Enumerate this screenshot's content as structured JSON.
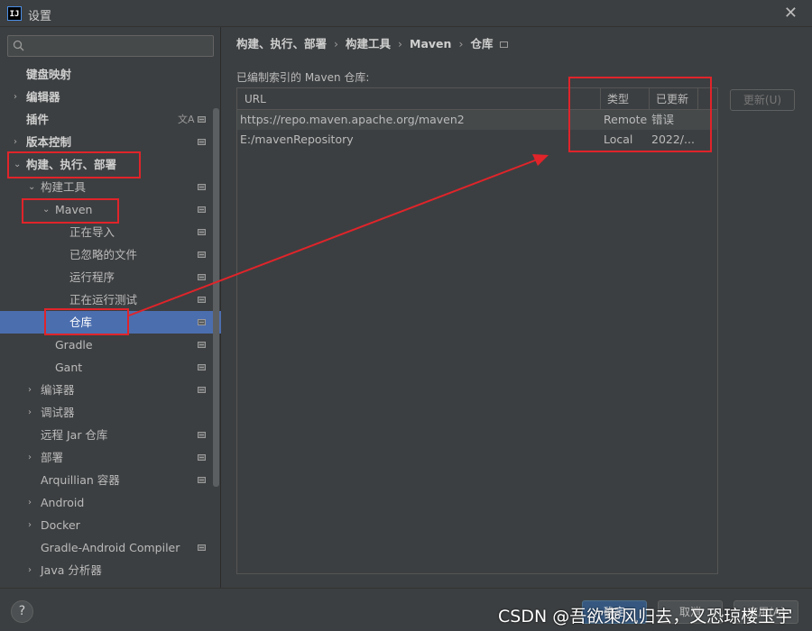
{
  "window": {
    "title": "设置",
    "app_icon_text": "IJ"
  },
  "search": {
    "placeholder": ""
  },
  "sidebar": {
    "items": [
      {
        "label": "键盘映射",
        "indent": 0,
        "arrow": "",
        "bold": true,
        "proj": false,
        "lang": false,
        "selected": false
      },
      {
        "label": "编辑器",
        "indent": 0,
        "arrow": "›",
        "bold": true,
        "proj": false,
        "lang": false,
        "selected": false
      },
      {
        "label": "插件",
        "indent": 0,
        "arrow": "",
        "bold": true,
        "proj": true,
        "lang": true,
        "selected": false
      },
      {
        "label": "版本控制",
        "indent": 0,
        "arrow": "›",
        "bold": true,
        "proj": true,
        "lang": false,
        "selected": false
      },
      {
        "label": "构建、执行、部署",
        "indent": 0,
        "arrow": "⌄",
        "bold": true,
        "proj": false,
        "lang": false,
        "selected": false
      },
      {
        "label": "构建工具",
        "indent": 1,
        "arrow": "⌄",
        "bold": false,
        "proj": true,
        "lang": false,
        "selected": false
      },
      {
        "label": "Maven",
        "indent": 2,
        "arrow": "⌄",
        "bold": false,
        "proj": true,
        "lang": false,
        "selected": false
      },
      {
        "label": "正在导入",
        "indent": 3,
        "arrow": "",
        "bold": false,
        "proj": true,
        "lang": false,
        "selected": false
      },
      {
        "label": "已忽略的文件",
        "indent": 3,
        "arrow": "",
        "bold": false,
        "proj": true,
        "lang": false,
        "selected": false
      },
      {
        "label": "运行程序",
        "indent": 3,
        "arrow": "",
        "bold": false,
        "proj": true,
        "lang": false,
        "selected": false
      },
      {
        "label": "正在运行测试",
        "indent": 3,
        "arrow": "",
        "bold": false,
        "proj": true,
        "lang": false,
        "selected": false
      },
      {
        "label": "仓库",
        "indent": 3,
        "arrow": "",
        "bold": false,
        "proj": true,
        "lang": false,
        "selected": true
      },
      {
        "label": "Gradle",
        "indent": 2,
        "arrow": "",
        "bold": false,
        "proj": true,
        "lang": false,
        "selected": false
      },
      {
        "label": "Gant",
        "indent": 2,
        "arrow": "",
        "bold": false,
        "proj": true,
        "lang": false,
        "selected": false
      },
      {
        "label": "编译器",
        "indent": 1,
        "arrow": "›",
        "bold": false,
        "proj": true,
        "lang": false,
        "selected": false
      },
      {
        "label": "调试器",
        "indent": 1,
        "arrow": "›",
        "bold": false,
        "proj": false,
        "lang": false,
        "selected": false
      },
      {
        "label": "远程 Jar 仓库",
        "indent": 1,
        "arrow": "",
        "bold": false,
        "proj": true,
        "lang": false,
        "selected": false
      },
      {
        "label": "部署",
        "indent": 1,
        "arrow": "›",
        "bold": false,
        "proj": true,
        "lang": false,
        "selected": false
      },
      {
        "label": "Arquillian 容器",
        "indent": 1,
        "arrow": "",
        "bold": false,
        "proj": true,
        "lang": false,
        "selected": false
      },
      {
        "label": "Android",
        "indent": 1,
        "arrow": "›",
        "bold": false,
        "proj": false,
        "lang": false,
        "selected": false
      },
      {
        "label": "Docker",
        "indent": 1,
        "arrow": "›",
        "bold": false,
        "proj": false,
        "lang": false,
        "selected": false
      },
      {
        "label": "Gradle-Android Compiler",
        "indent": 1,
        "arrow": "",
        "bold": false,
        "proj": true,
        "lang": false,
        "selected": false
      },
      {
        "label": "Java 分析器",
        "indent": 1,
        "arrow": "›",
        "bold": false,
        "proj": false,
        "lang": false,
        "selected": false
      }
    ]
  },
  "breadcrumb": {
    "items": [
      "构建、执行、部署",
      "构建工具",
      "Maven",
      "仓库"
    ]
  },
  "repos": {
    "section_label": "已编制索引的 Maven 仓库:",
    "columns": [
      "URL",
      "类型",
      "已更新"
    ],
    "rows": [
      {
        "url": "https://repo.maven.apache.org/maven2",
        "type": "Remote",
        "updated": "错误"
      },
      {
        "url": "E:/mavenRepository",
        "type": "Local",
        "updated": "2022/..."
      }
    ],
    "update_button": "更新(U)"
  },
  "footer": {
    "help": "?",
    "ok": "确定",
    "cancel": "取消",
    "apply": "应用(A)",
    "watermark": "CSDN @吾欲乘风归去，又恐琼楼玉宇"
  },
  "colors": {
    "selection": "#4b6eaf",
    "annotation": "#e0242a",
    "background": "#3c3f41"
  }
}
